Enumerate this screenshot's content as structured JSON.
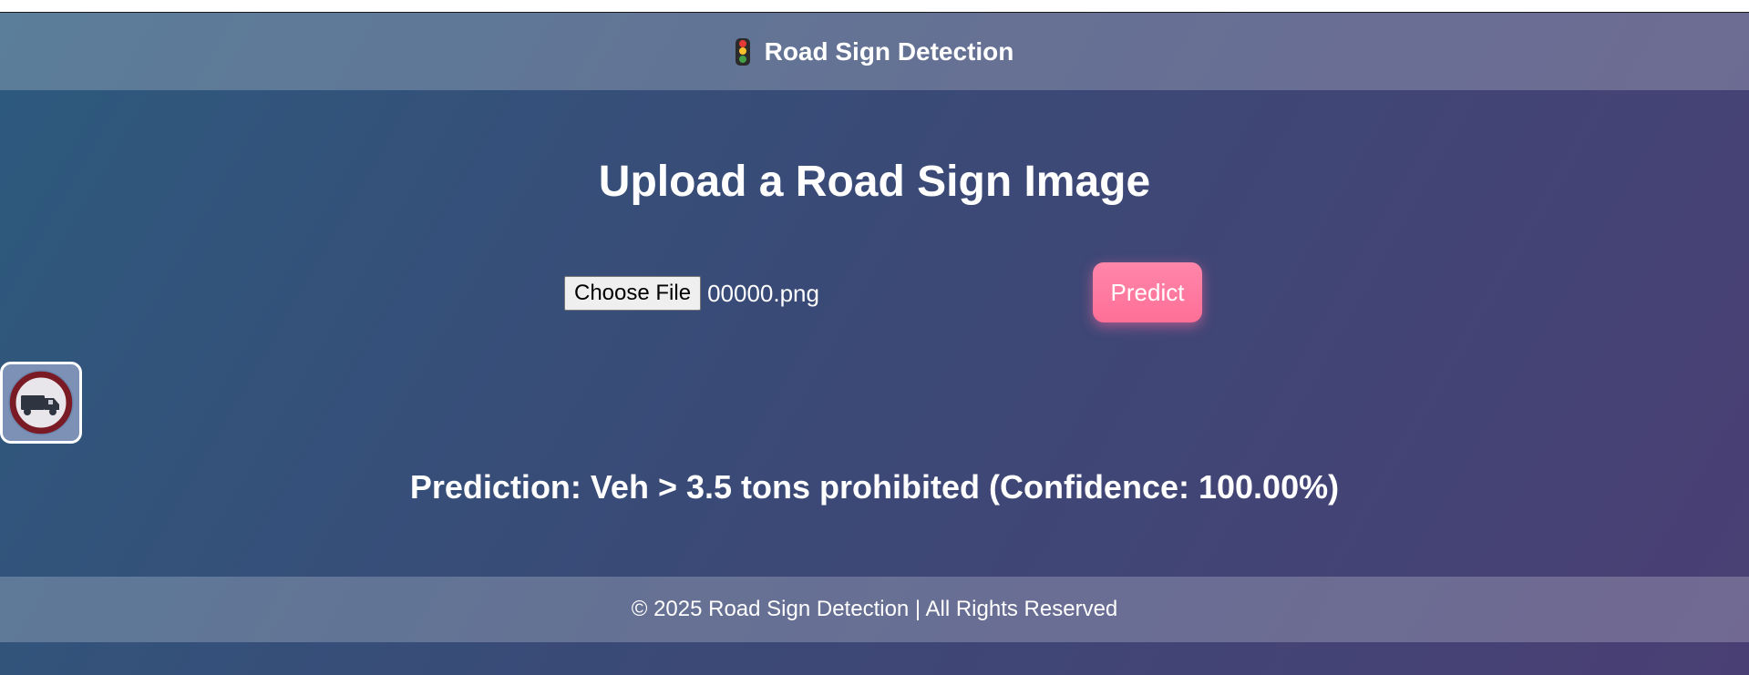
{
  "header": {
    "icon": "traffic-light-icon",
    "title": "Road Sign Detection"
  },
  "main": {
    "title": "Upload a Road Sign Image",
    "file_button_label": "Choose File",
    "file_name": "00000.png",
    "predict_label": "Predict",
    "preview_icon": "no-trucks-sign-icon",
    "prediction": "Prediction: Veh > 3.5 tons prohibited (Confidence: 100.00%)"
  },
  "footer": {
    "text": "© 2025 Road Sign Detection | All Rights Reserved"
  },
  "colors": {
    "accent": "#ff7aa0",
    "background_start": "#2d5a7e",
    "background_end": "#4a3f74"
  }
}
